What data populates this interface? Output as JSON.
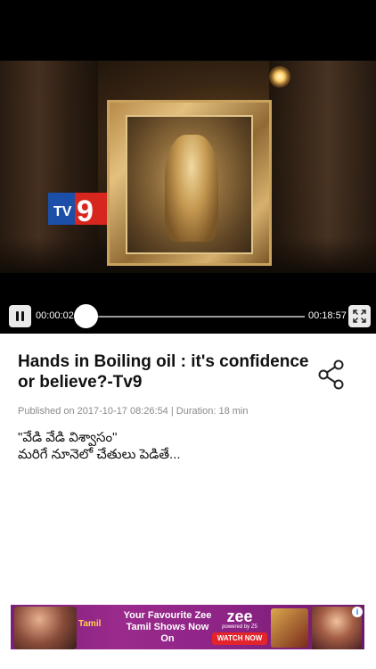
{
  "player": {
    "logo_text": "tv9",
    "elapsed": "00:00:02",
    "total": "00:18:57",
    "progress_fraction": 0.002
  },
  "video": {
    "title": "Hands in Boiling oil :  it's confidence or believe?-Tv9",
    "meta": "Published on 2017-10-17 08:26:54 | Duration: 18 min",
    "description_line1": "\"వేడి వేడి విశ్వాసం\"",
    "description_line2": "మరిగే నూనెలో చేతులు పెడితే..."
  },
  "ad": {
    "left_logo": "Tamil",
    "headline": "Your Favourite Zee Tamil Shows Now On",
    "brand": "zee",
    "brand_sub": "powered by Z5",
    "cta": "WATCH NOW",
    "info_icon": "i",
    "close_icon": "✕"
  },
  "colors": {
    "ad_background": "#8e2486",
    "cta_red": "#e3242b",
    "ad_choice_blue": "#1a73e8"
  }
}
